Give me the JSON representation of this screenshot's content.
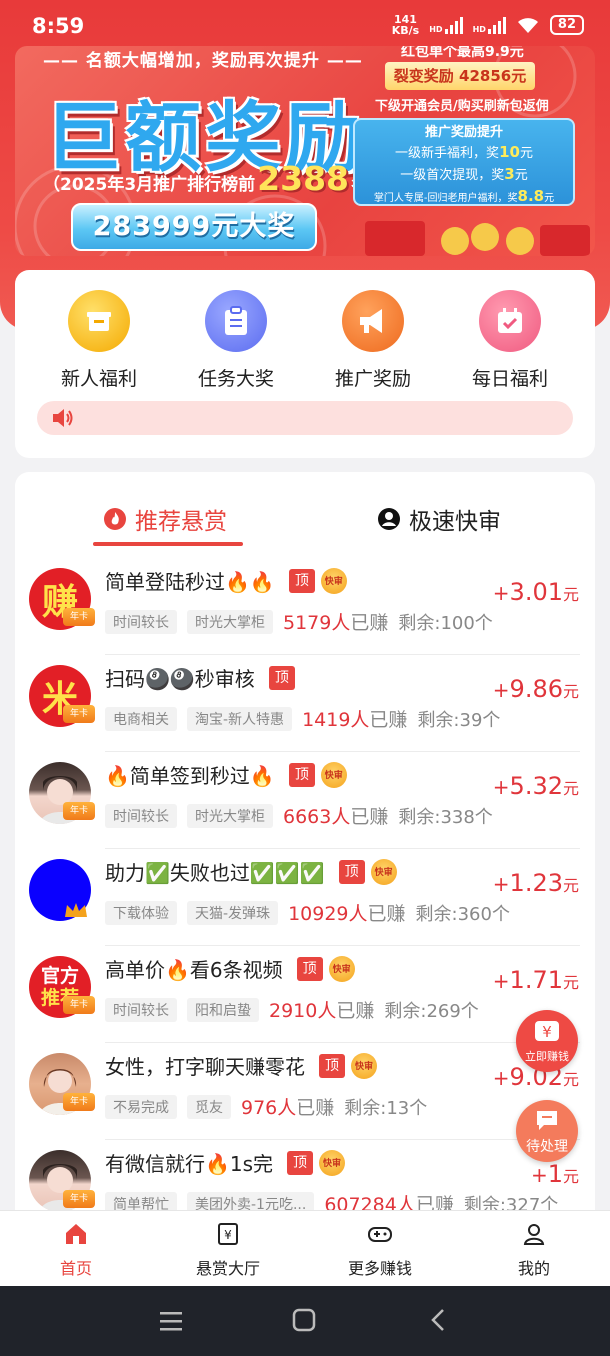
{
  "status_bar": {
    "time": "8:59",
    "net_speed_value": "141",
    "net_speed_unit": "KB/s",
    "hd1": "HD",
    "hd2": "HD",
    "battery": "82"
  },
  "banner": {
    "top_line": "—— 名额大幅增加，奖励再次提升 ——",
    "big_title": "巨额奖励",
    "rank_prefix": "（2025年3月推广排行榜前",
    "rank_number": "2388",
    "rank_suffix": "名）",
    "prize": "283999元大奖",
    "red_packet_line": "红包单个最高9.9元",
    "fission_reward": "裂变奖励 42856元",
    "subscribe_line": "下级开通会员/购买刷新包返佣",
    "promo_title": "推广奖励提升",
    "promo_line1_text": "一级新手福利，奖",
    "promo_line1_value": "10",
    "promo_line1_unit": "元",
    "promo_line2_text": "一级首次提现，奖",
    "promo_line2_value": "3",
    "promo_line2_unit": "元",
    "promo_line3_text": "掌门人专属-回归老用户福利，奖",
    "promo_line3_value": "8.8",
    "promo_line3_unit": "元"
  },
  "quick_actions": [
    {
      "label": "新人福利",
      "icon": "gift-box-icon",
      "color": "#f7b500"
    },
    {
      "label": "任务大奖",
      "icon": "clipboard-icon",
      "color": "#6b7cf6"
    },
    {
      "label": "推广奖励",
      "icon": "megaphone-icon",
      "color": "#f2742c"
    },
    {
      "label": "每日福利",
      "icon": "calendar-check-icon",
      "color": "#f25a7a"
    }
  ],
  "tabs": {
    "recommended": "推荐悬赏",
    "fast_review": "极速快审"
  },
  "badges": {
    "top": "顶",
    "fast": "快审",
    "card": "年卡"
  },
  "avatar_text": {
    "zhuan": "赚",
    "mi": "米",
    "official_line1": "官方",
    "official_line2": "推荐"
  },
  "tasks": [
    {
      "title": "简单登陆秒过🔥🔥",
      "tag1": "时间较长",
      "tag2": "时光大掌柜",
      "earned": "5179人",
      "earned_suffix": "已赚",
      "remaining": "剩余:100个",
      "reward_sign": "+",
      "reward": "3.01",
      "unit": "元"
    },
    {
      "title": "扫码🎱🎱秒审核",
      "tag1": "电商相关",
      "tag2": "淘宝-新人特惠",
      "earned": "1419人",
      "earned_suffix": "已赚",
      "remaining": "剩余:39个",
      "reward_sign": "+",
      "reward": "9.86",
      "unit": "元"
    },
    {
      "title": "🔥简单签到秒过🔥",
      "tag1": "时间较长",
      "tag2": "时光大掌柜",
      "earned": "6663人",
      "earned_suffix": "已赚",
      "remaining": "剩余:338个",
      "reward_sign": "+",
      "reward": "5.32",
      "unit": "元"
    },
    {
      "title": "助力✅失败也过✅✅✅",
      "tag1": "下载体验",
      "tag2": "天猫-发弹珠",
      "earned": "10929人",
      "earned_suffix": "已赚",
      "remaining": "剩余:360个",
      "reward_sign": "+",
      "reward": "1.23",
      "unit": "元"
    },
    {
      "title": "高单价🔥看6条视频",
      "tag1": "时间较长",
      "tag2": "阳和启蛰",
      "earned": "2910人",
      "earned_suffix": "已赚",
      "remaining": "剩余:269个",
      "reward_sign": "+",
      "reward": "1.71",
      "unit": "元"
    },
    {
      "title": "女性，打字聊天赚零花",
      "tag1": "不易完成",
      "tag2": "觅友",
      "earned": "976人",
      "earned_suffix": "已赚",
      "remaining": "剩余:13个",
      "reward_sign": "+",
      "reward": "9.02",
      "unit": "元"
    },
    {
      "title": "有微信就行🔥1s完",
      "tag1": "简单帮忙",
      "tag2": "美团外卖-1元吃...",
      "earned": "607284人",
      "earned_suffix": "已赚",
      "remaining": "剩余:327个",
      "reward_sign": "+",
      "reward": "1",
      "unit": "元"
    }
  ],
  "floating": {
    "earn_now": "立即赚钱",
    "pending": "待处理"
  },
  "bottom_nav": [
    {
      "label": "首页",
      "icon": "home-icon",
      "active": true
    },
    {
      "label": "悬赏大厅",
      "icon": "yuan-receipt-icon",
      "active": false
    },
    {
      "label": "更多赚钱",
      "icon": "gamepad-icon",
      "active": false
    },
    {
      "label": "我的",
      "icon": "user-icon",
      "active": false
    }
  ],
  "colors": {
    "accent": "#e8453f",
    "reward": "#e0353b"
  }
}
